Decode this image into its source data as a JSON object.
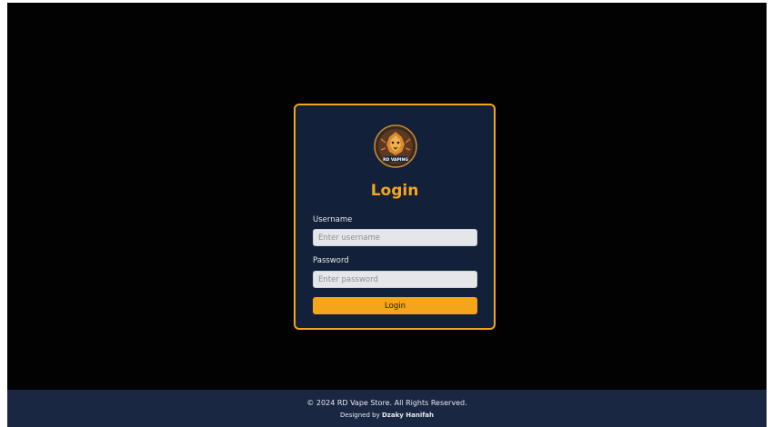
{
  "brand": {
    "logo_text": "RD VAPING"
  },
  "login": {
    "title": "Login",
    "username_label": "Username",
    "username_placeholder": "Enter username",
    "password_label": "Password",
    "password_placeholder": "Enter password",
    "submit_label": "Login"
  },
  "footer": {
    "copyright": "© 2024 RD Vape Store. All Rights Reserved.",
    "designed_by": "Designed by",
    "designer": "Dzaky Hanifah"
  },
  "colors": {
    "page_bg": "#020202",
    "card_bg": "#13203a",
    "accent": "#f4a51c",
    "footer_bg": "#1a2742"
  },
  "icons": {
    "logo": "lion-emblem-logo"
  }
}
